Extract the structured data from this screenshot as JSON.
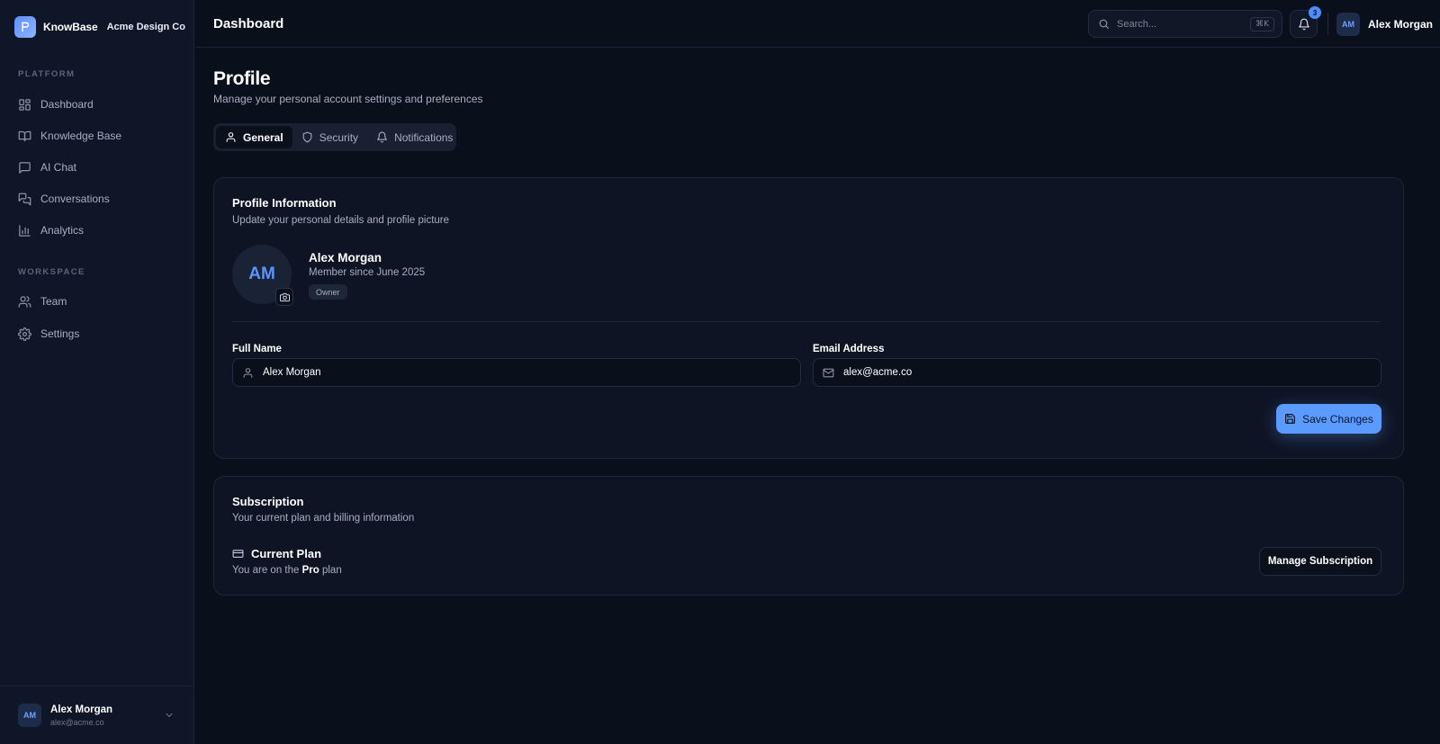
{
  "brand": {
    "name": "KnowBase",
    "org": "Acme Design Co"
  },
  "sidebar": {
    "sections": [
      {
        "label": "PLATFORM"
      },
      {
        "label": "WORKSPACE"
      }
    ],
    "items": [
      {
        "label": "Dashboard",
        "icon": "grid-icon"
      },
      {
        "label": "Knowledge Base",
        "icon": "book-icon"
      },
      {
        "label": "AI Chat",
        "icon": "message-square-icon"
      },
      {
        "label": "Conversations",
        "icon": "messages-icon"
      },
      {
        "label": "Analytics",
        "icon": "bar-chart-icon"
      },
      {
        "label": "Team",
        "icon": "users-icon"
      },
      {
        "label": "Settings",
        "icon": "gear-icon"
      }
    ],
    "footer": {
      "initials": "AM",
      "name": "Alex Morgan",
      "email": "alex@acme.co"
    }
  },
  "topbar": {
    "title": "Dashboard",
    "search_placeholder": "Search...",
    "search_shortcut": "⌘K",
    "notification_count": "3",
    "user_initials": "AM",
    "user_name": "Alex Morgan"
  },
  "page": {
    "title": "Profile",
    "subtitle": "Manage your personal account settings and preferences",
    "tabs": [
      {
        "label": "General",
        "active": true
      },
      {
        "label": "Security",
        "active": false
      },
      {
        "label": "Notifications",
        "active": false
      }
    ]
  },
  "profile_card": {
    "title": "Profile Information",
    "description": "Update your personal details and profile picture",
    "avatar_initials": "AM",
    "name": "Alex Morgan",
    "member_since": "Member since June 2025",
    "role": "Owner",
    "full_name_label": "Full Name",
    "full_name_value": "Alex Morgan",
    "email_label": "Email Address",
    "email_value": "alex@acme.co",
    "save_label": "Save Changes"
  },
  "subscription_card": {
    "title": "Subscription",
    "description": "Your current plan and billing information",
    "plan_title": "Current Plan",
    "plan_prefix": "You are on the",
    "plan_name": "Pro",
    "plan_suffix": "plan",
    "manage_label": "Manage Subscription"
  },
  "colors": {
    "background": "#0a0f1c",
    "sidebar": "#0f1627",
    "accent": "#5b9bff",
    "card": "#0e1424",
    "border": "#1e263a"
  }
}
